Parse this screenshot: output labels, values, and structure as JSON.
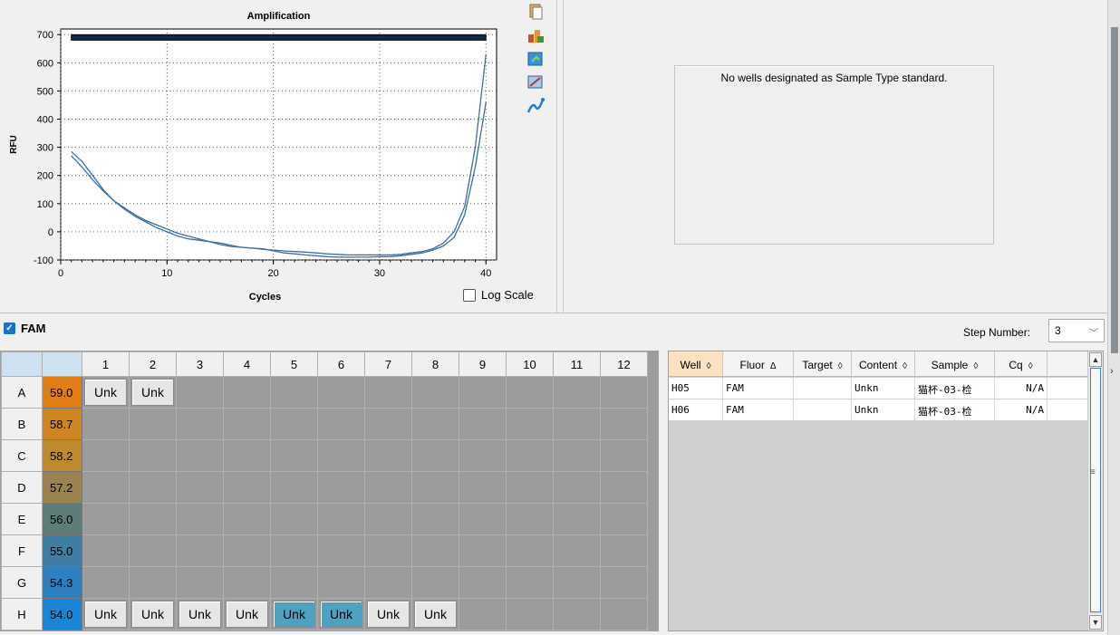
{
  "chart": {
    "title": "Amplification",
    "xlabel": "Cycles",
    "ylabel": "RFU",
    "log_scale_label": "Log Scale",
    "toolbar": [
      "copy-icon",
      "export-data-icon",
      "export-image-icon",
      "zoom-icon",
      "curve-icon"
    ]
  },
  "chart_data": {
    "type": "line",
    "title": "Amplification",
    "xlabel": "Cycles",
    "ylabel": "RFU",
    "xlim": [
      0,
      41
    ],
    "ylim": [
      -100,
      720
    ],
    "xticks": [
      0,
      10,
      20,
      30,
      40
    ],
    "yticks": [
      -100,
      0,
      100,
      200,
      300,
      400,
      500,
      600,
      700
    ],
    "grid": true,
    "threshold": 690,
    "series": [
      {
        "x": [
          1,
          2,
          3,
          4,
          5,
          6,
          7,
          8,
          9,
          10,
          11,
          12,
          13,
          14,
          15,
          16,
          17,
          18,
          19,
          20,
          21,
          22,
          23,
          24,
          25,
          26,
          27,
          28,
          29,
          30,
          31,
          32,
          33,
          34,
          35,
          36,
          37,
          38,
          39,
          40
        ],
        "values": [
          285,
          250,
          200,
          150,
          110,
          80,
          55,
          35,
          15,
          0,
          -15,
          -25,
          -30,
          -35,
          -40,
          -48,
          -55,
          -58,
          -62,
          -65,
          -68,
          -70,
          -72,
          -75,
          -78,
          -80,
          -82,
          -82,
          -82,
          -82,
          -82,
          -80,
          -75,
          -70,
          -60,
          -40,
          0,
          90,
          300,
          630
        ]
      },
      {
        "x": [
          1,
          2,
          3,
          4,
          5,
          6,
          7,
          8,
          9,
          10,
          11,
          12,
          13,
          14,
          15,
          16,
          17,
          18,
          19,
          20,
          21,
          22,
          23,
          24,
          25,
          26,
          27,
          28,
          29,
          30,
          31,
          32,
          33,
          34,
          35,
          36,
          37,
          38,
          39,
          40
        ],
        "values": [
          270,
          230,
          185,
          145,
          110,
          85,
          60,
          40,
          25,
          10,
          -5,
          -15,
          -25,
          -35,
          -45,
          -52,
          -55,
          -58,
          -60,
          -68,
          -75,
          -78,
          -82,
          -85,
          -88,
          -90,
          -90,
          -90,
          -90,
          -88,
          -88,
          -85,
          -80,
          -75,
          -65,
          -50,
          -20,
          60,
          230,
          460
        ]
      }
    ]
  },
  "standard": {
    "message": "No wells designated as Sample Type standard."
  },
  "fam": {
    "label": "FAM",
    "step_label": "Step Number:",
    "step_value": "3"
  },
  "plate": {
    "columns": [
      "1",
      "2",
      "3",
      "4",
      "5",
      "6",
      "7",
      "8",
      "9",
      "10",
      "11",
      "12"
    ],
    "rows": [
      {
        "label": "A",
        "temp": "59.0",
        "color": "#e07d14",
        "wells": [
          "Unk",
          "Unk",
          "",
          "",
          "",
          "",
          "",
          "",
          "",
          "",
          "",
          ""
        ],
        "blue": []
      },
      {
        "label": "B",
        "temp": "58.7",
        "color": "#cf8520",
        "wells": [
          "",
          "",
          "",
          "",
          "",
          "",
          "",
          "",
          "",
          "",
          "",
          ""
        ],
        "blue": []
      },
      {
        "label": "C",
        "temp": "58.2",
        "color": "#bd8a2e",
        "wells": [
          "",
          "",
          "",
          "",
          "",
          "",
          "",
          "",
          "",
          "",
          "",
          ""
        ],
        "blue": []
      },
      {
        "label": "D",
        "temp": "57.2",
        "color": "#9b8350",
        "wells": [
          "",
          "",
          "",
          "",
          "",
          "",
          "",
          "",
          "",
          "",
          "",
          ""
        ],
        "blue": []
      },
      {
        "label": "E",
        "temp": "56.0",
        "color": "#5f7d78",
        "wells": [
          "",
          "",
          "",
          "",
          "",
          "",
          "",
          "",
          "",
          "",
          "",
          ""
        ],
        "blue": []
      },
      {
        "label": "F",
        "temp": "55.0",
        "color": "#3f7ea3",
        "wells": [
          "",
          "",
          "",
          "",
          "",
          "",
          "",
          "",
          "",
          "",
          "",
          ""
        ],
        "blue": []
      },
      {
        "label": "G",
        "temp": "54.3",
        "color": "#2d80bf",
        "wells": [
          "",
          "",
          "",
          "",
          "",
          "",
          "",
          "",
          "",
          "",
          "",
          ""
        ],
        "blue": []
      },
      {
        "label": "H",
        "temp": "54.0",
        "color": "#1a84d6",
        "wells": [
          "Unk",
          "Unk",
          "Unk",
          "Unk",
          "Unk",
          "Unk",
          "Unk",
          "Unk",
          "",
          "",
          "",
          ""
        ],
        "blue": [
          4,
          5
        ]
      }
    ]
  },
  "results": {
    "headers": [
      "Well",
      "Fluor",
      "Target",
      "Content",
      "Sample",
      "Cq"
    ],
    "sort_marks": [
      "◊",
      "Δ",
      "◊",
      "◊",
      "◊",
      "◊"
    ],
    "rows": [
      [
        "H05",
        "FAM",
        "",
        "Unkn",
        "猫杯-03-检",
        "N/A"
      ],
      [
        "H06",
        "FAM",
        "",
        "Unkn",
        "猫杯-03-检",
        "N/A"
      ]
    ]
  }
}
